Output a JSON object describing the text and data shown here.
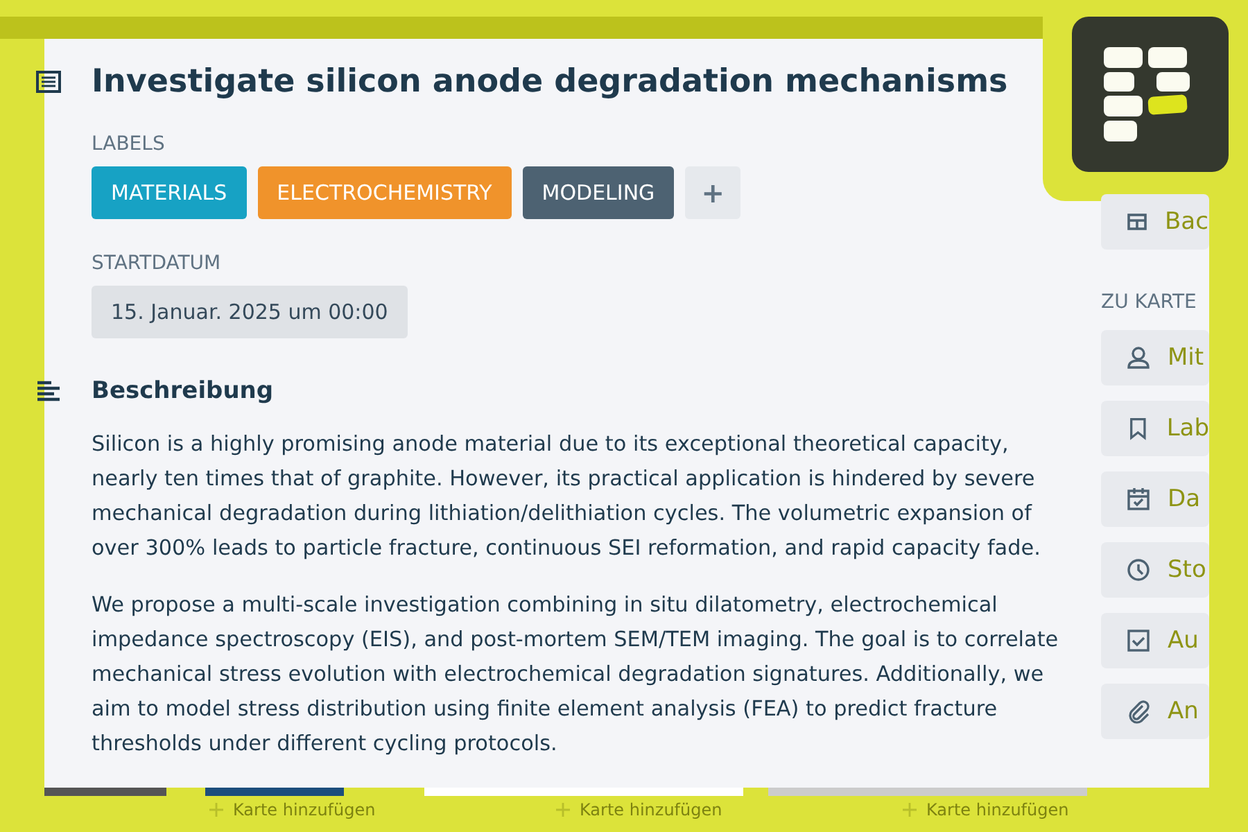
{
  "card": {
    "title": "Investigate silicon anode degradation mechanisms",
    "labels_heading": "LABELS",
    "labels": [
      {
        "text": "MATERIALS",
        "color": "#17a2c4"
      },
      {
        "text": "ELECTROCHEMISTRY",
        "color": "#f0932b"
      },
      {
        "text": "MODELING",
        "color": "#4d6272"
      }
    ],
    "add_label": "+",
    "start_heading": "STARTDATUM",
    "start_date": "15. Januar. 2025 um 00:00",
    "description_heading": "Beschreibung",
    "description": [
      "Silicon is a highly promising anode material due to its exceptional theoretical capacity, nearly ten times that of graphite. However, its practical application is hindered by severe mechanical degradation during lithiation/delithiation cycles. The volumetric expansion of over 300% leads to particle fracture, continuous SEI reformation, and rapid capacity fade.",
      "We propose a multi-scale investigation combining in situ dilatometry, electrochemical impedance spectroscopy (EIS), and post-mortem SEM/TEM imaging. The goal is to correlate mechanical stress evolution with electrochemical degradation signatures. Additionally, we aim to model stress distribution using finite element analysis (FEA) to predict fracture thresholds under different cycling protocols."
    ]
  },
  "sidebar": {
    "top_buttons": [
      {
        "kind": "board",
        "text": "Bac"
      }
    ],
    "heading": "ZU KARTE",
    "buttons": [
      {
        "kind": "user",
        "text": "Mit"
      },
      {
        "kind": "label",
        "text": "Lab"
      },
      {
        "kind": "date",
        "text": "Da"
      },
      {
        "kind": "clock",
        "text": "Sto"
      },
      {
        "kind": "check",
        "text": "Au"
      },
      {
        "kind": "clip",
        "text": "An"
      }
    ]
  },
  "board_footer": [
    "Karte hinzufügen",
    "Karte hinzufügen",
    "Karte hinzufügen"
  ]
}
